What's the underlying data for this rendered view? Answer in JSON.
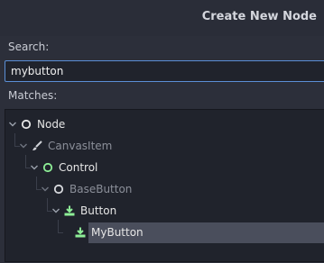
{
  "dialog": {
    "title": "Create New Node"
  },
  "search": {
    "label": "Search:",
    "value": "mybutton"
  },
  "matches": {
    "label": "Matches:"
  },
  "tree": {
    "items": [
      {
        "label": "Node",
        "icon": "node-circle-icon",
        "dim": false
      },
      {
        "label": "CanvasItem",
        "icon": "brush-icon",
        "dim": true
      },
      {
        "label": "Control",
        "icon": "control-circle-icon",
        "dim": false
      },
      {
        "label": "BaseButton",
        "icon": "node-circle-icon",
        "dim": true
      },
      {
        "label": "Button",
        "icon": "button-icon",
        "dim": false
      },
      {
        "label": "MyButton",
        "icon": "button-icon",
        "dim": false,
        "selected": true
      }
    ]
  },
  "colors": {
    "accent_green": "#8eef97",
    "selection": "#4a4e5c",
    "focus_border": "#5b8fd6"
  }
}
